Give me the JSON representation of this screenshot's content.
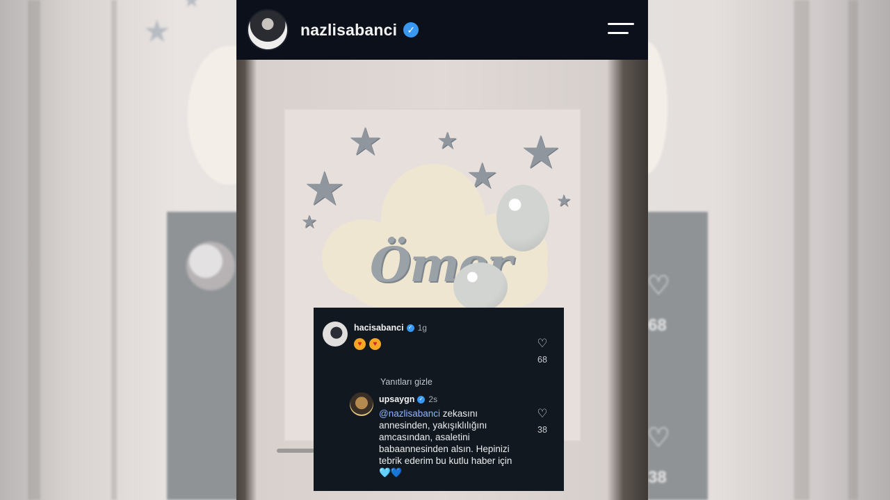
{
  "post": {
    "username": "nazlisabanci",
    "verified_mark": "✓",
    "menu_icon": "hamburger-menu-icon"
  },
  "photo": {
    "name_sign": "Ömer"
  },
  "comments": [
    {
      "username": "hacisabanci",
      "time": "1g",
      "text": "😍😍",
      "likes": "68"
    }
  ],
  "hide_replies_label": "Yanıtları gizle",
  "replies": [
    {
      "username": "upsaygn",
      "time": "2s",
      "mention": "@nazlisabanci",
      "text": " zekasını annesinden, yakışıklılığını amcasından, asaletini babaannesinden alsın. Hepinizi tebrik ederim bu kutlu haber için ",
      "emojis": "🩵💙",
      "likes": "38"
    }
  ],
  "background": {
    "counts": [
      "68",
      "38"
    ]
  }
}
